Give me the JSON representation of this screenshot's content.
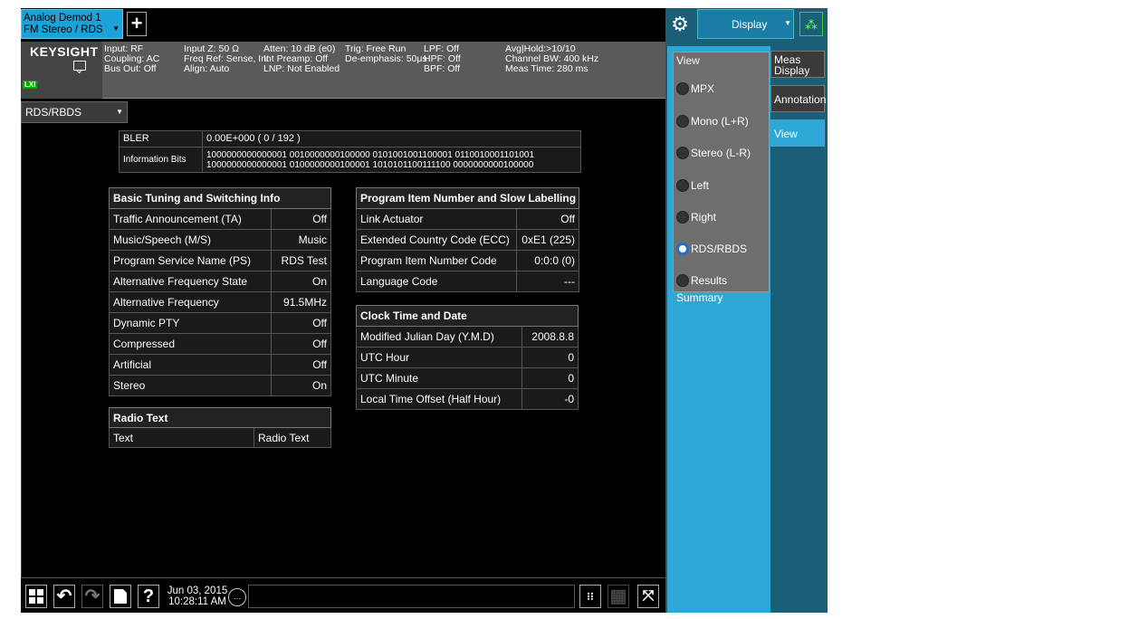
{
  "app": {
    "tab_title_line1": "Analog Demod 1",
    "tab_title_line2": "FM Stereo / RDS",
    "add_tab": "+"
  },
  "status": {
    "logo": "KEYSIGHT",
    "lxi": "LXI",
    "col1": "Input: RF\nCoupling: AC\nBus Out: Off",
    "col2": "Input Z: 50 Ω\nFreq Ref: Sense, Int\nAlign: Auto",
    "col3": "Atten: 10 dB (e0)\nInt Preamp: Off\nLNP: Not Enabled",
    "col4": "Trig: Free Run\nDe-emphasis: 50μs",
    "col5": "LPF: Off\nHPF: Off\nBPF: Off",
    "col6": "Avg|Hold:>10/10\nChannel BW: 400 kHz\nMeas Time: 280 ms"
  },
  "measurement": {
    "selector": "RDS/RBDS"
  },
  "bits": {
    "bler_label": "BLER",
    "bler_value": "0.00E+000 ( 0 / 192 )",
    "info_label": "Information Bits",
    "info_line1": "1000000000000001 0010000000100000 0101001001100001 0110010001101001",
    "info_line2": "1000000000000001 0100000000100001 1010101100111100 0000000000100000"
  },
  "basic": {
    "title": "Basic Tuning and Switching Info",
    "rows": [
      {
        "label": "Traffic Announcement (TA)",
        "value": "Off"
      },
      {
        "label": "Music/Speech (M/S)",
        "value": "Music"
      },
      {
        "label": "Program Service Name (PS)",
        "value": "RDS Test"
      },
      {
        "label": "Alternative Frequency State",
        "value": "On"
      },
      {
        "label": "Alternative Frequency",
        "value": "91.5MHz"
      },
      {
        "label": "Dynamic PTY",
        "value": "Off"
      },
      {
        "label": "Compressed",
        "value": "Off"
      },
      {
        "label": "Artificial",
        "value": "Off"
      },
      {
        "label": "Stereo",
        "value": "On"
      }
    ]
  },
  "pin": {
    "title": "Program Item Number and Slow Labelling Codes",
    "rows": [
      {
        "label": "Link Actuator",
        "value": "Off"
      },
      {
        "label": "Extended Country Code (ECC)",
        "value": "0xE1 (225)"
      },
      {
        "label": "Program Item Number Code",
        "value": "0:0:0 (0)"
      },
      {
        "label": "Language Code",
        "value": "---"
      }
    ]
  },
  "clock": {
    "title": "Clock Time and Date",
    "rows": [
      {
        "label": "Modified Julian Day (Y.M.D)",
        "value": "2008.8.8"
      },
      {
        "label": "UTC Hour",
        "value": "0"
      },
      {
        "label": "UTC Minute",
        "value": "0"
      },
      {
        "label": "Local Time Offset (Half Hour)",
        "value": "-0"
      }
    ]
  },
  "radio": {
    "title": "Radio Text",
    "label": "Text",
    "value": "Radio Text"
  },
  "taskbar": {
    "date": "Jun 03, 2015",
    "time": "10:28:11 AM"
  },
  "side": {
    "display_label": "Display",
    "view_title": "View",
    "options": [
      {
        "label": "MPX",
        "selected": false
      },
      {
        "label": "Mono (L+R)",
        "selected": false
      },
      {
        "label": "Stereo (L-R)",
        "selected": false
      },
      {
        "label": "Left",
        "selected": false
      },
      {
        "label": "Right",
        "selected": false
      },
      {
        "label": "RDS/RBDS",
        "selected": true
      },
      {
        "label": "Results Summary",
        "selected": false
      }
    ],
    "tabs": [
      "Meas\nDisplay",
      "Annotation",
      "View"
    ]
  },
  "colors": {
    "accent": "#2da7d6",
    "sidebar": "#1a5e78",
    "menu_bg": "#6e6e6e",
    "tab_active": "#1ba3d9"
  }
}
